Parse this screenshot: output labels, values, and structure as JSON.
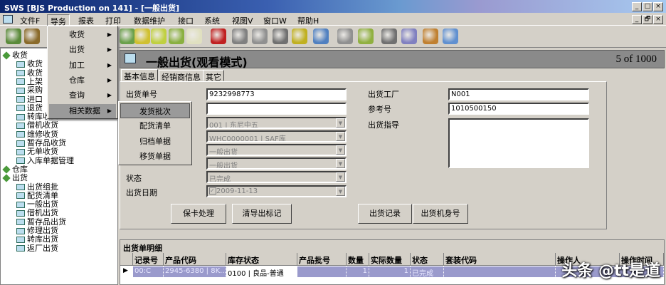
{
  "window": {
    "title": "SWS [BJS Production on 141] - [一般出货]",
    "min": "_",
    "max": "□",
    "close": "×",
    "restore": "🗗"
  },
  "menubar": [
    "文件F",
    "导务",
    "报表",
    "打印",
    "数据维护",
    "接口",
    "系统",
    "视图V",
    "窗口W",
    "帮助H"
  ],
  "dropdown": {
    "items": [
      "收货",
      "出货",
      "加工",
      "仓库",
      "查询",
      "相关数据"
    ],
    "highlighted": 5
  },
  "submenu": {
    "items": [
      "发货批次",
      "配货清单",
      "归档单据",
      "移货单据"
    ],
    "highlighted": 0
  },
  "tree": [
    {
      "label": "收货",
      "level": 0
    },
    {
      "label": "收货",
      "level": 1
    },
    {
      "label": "收货",
      "level": 1
    },
    {
      "label": "上架",
      "level": 1
    },
    {
      "label": "采购",
      "level": 1
    },
    {
      "label": "进口",
      "level": 1
    },
    {
      "label": "退货",
      "level": 1
    },
    {
      "label": "转库收货",
      "level": 1
    },
    {
      "label": "借机收货",
      "level": 1
    },
    {
      "label": "维修收货",
      "level": 1
    },
    {
      "label": "暂存品收货",
      "level": 1
    },
    {
      "label": "无单收货",
      "level": 1
    },
    {
      "label": "入库单据管理",
      "level": 1
    },
    {
      "label": "仓库",
      "level": 0
    },
    {
      "label": "出货",
      "level": 0
    },
    {
      "label": "出货组批",
      "level": 1
    },
    {
      "label": "配货清单",
      "level": 1
    },
    {
      "label": "一般出货",
      "level": 1
    },
    {
      "label": "借机出货",
      "level": 1
    },
    {
      "label": "暂存品出货",
      "level": 1
    },
    {
      "label": "修理出货",
      "level": 1
    },
    {
      "label": "转库出货",
      "level": 1
    },
    {
      "label": "返厂出货",
      "level": 1
    }
  ],
  "header": {
    "title": "一般出货(观看模式)",
    "record": "5 of 1000"
  },
  "tabs": [
    "基本信息",
    "经销商信息",
    "其它"
  ],
  "form": {
    "left_labels": {
      "order_no": "出货单号",
      "status": "状态",
      "date": "出货日期"
    },
    "order_no": "9232998773",
    "field2": "",
    "customer": "001 | 东尼中五",
    "warehouse": "WHC0000001 | SAF库",
    "type1": "一般出货",
    "type2": "一般出货",
    "status": "已完成",
    "date": "2009-11-13",
    "right_labels": {
      "factory": "出货工厂",
      "ref": "参考号",
      "guide": "出货指导"
    },
    "factory": "N001",
    "ref": "1010500150",
    "guide": ""
  },
  "buttons": [
    "保卡处理",
    "清导出标记",
    "出货记录",
    "出货机身号"
  ],
  "grid": {
    "title": "出货单明细",
    "columns": [
      "记录号",
      "产品代码",
      "库存状态",
      "产品批号",
      "数量",
      "实际数量",
      "状态",
      "套装代码",
      "操作人",
      "操作时间"
    ],
    "rows": [
      [
        "00:C",
        "2945-6380 | 8K...",
        "0100 | 良品-普通",
        "",
        "1",
        "1",
        "已完成",
        "",
        "",
        ""
      ]
    ]
  },
  "watermark": "头条 @tt是道"
}
